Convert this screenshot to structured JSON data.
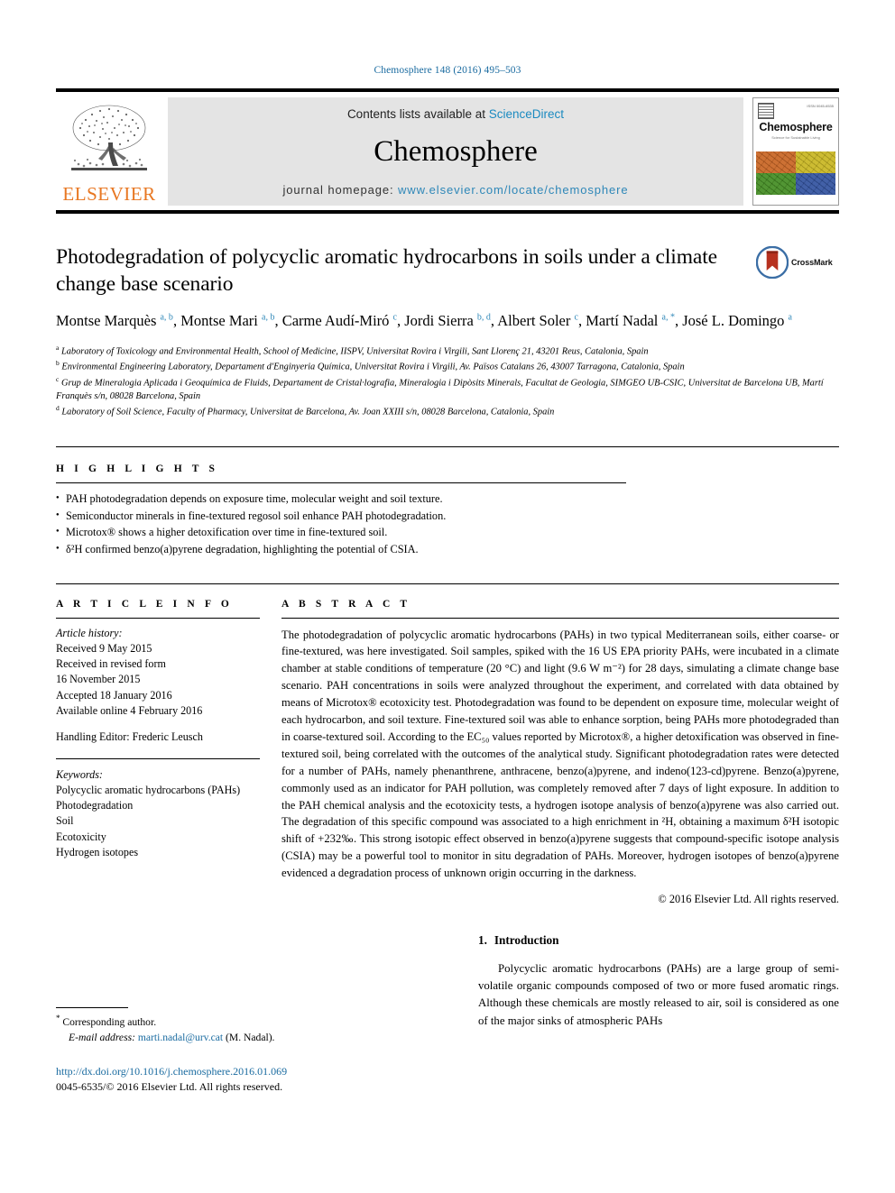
{
  "running_head": "Chemosphere 148 (2016) 495–503",
  "masthead": {
    "contents_prefix": "Contents lists available at ",
    "sciencedirect": "ScienceDirect",
    "journal_name": "Chemosphere",
    "homepage_prefix": "journal homepage: ",
    "homepage_url": "www.elsevier.com/locate/chemosphere",
    "publisher": "ELSEVIER",
    "cover": {
      "title": "Chemosphere",
      "subtitle": "Science for Sustainable Living",
      "issn": "ISSN 0045-6535",
      "colors": [
        "#c8621f",
        "#c8b51d",
        "#3f8a1e",
        "#2e4f9e"
      ]
    }
  },
  "article": {
    "title": "Photodegradation of polycyclic aromatic hydrocarbons in soils under a climate change base scenario",
    "crossmark_label": "CrossMark",
    "authors_html": "Montse Marquès <sup>a, b</sup>, Montse Mari <sup>a, b</sup>, Carme Audí-Miró <sup>c</sup>, Jordi Sierra <sup>b, d</sup>, Albert Soler <sup>c</sup>, Martí Nadal <sup>a, *</sup>, José L. Domingo <sup>a</sup>",
    "affiliations": [
      {
        "letter": "a",
        "text": "Laboratory of Toxicology and Environmental Health, School of Medicine, IISPV, Universitat Rovira i Virgili, Sant Llorenç 21, 43201 Reus, Catalonia, Spain"
      },
      {
        "letter": "b",
        "text": "Environmental Engineering Laboratory, Departament d'Enginyeria Química, Universitat Rovira i Virgili, Av. Països Catalans 26, 43007 Tarragona, Catalonia, Spain"
      },
      {
        "letter": "c",
        "text": "Grup de Mineralogia Aplicada i Geoquímica de Fluids, Departament de Cristal·lografia, Mineralogia i Dipòsits Minerals, Facultat de Geologia, SIMGEO UB-CSIC, Universitat de Barcelona UB, Martí Franquès s/n, 08028 Barcelona, Spain"
      },
      {
        "letter": "d",
        "text": "Laboratory of Soil Science, Faculty of Pharmacy, Universitat de Barcelona, Av. Joan XXIII s/n, 08028 Barcelona, Catalonia, Spain"
      }
    ]
  },
  "highlights": {
    "heading": "H I G H L I G H T S",
    "items": [
      "PAH photodegradation depends on exposure time, molecular weight and soil texture.",
      "Semiconductor minerals in fine-textured regosol soil enhance PAH photodegradation.",
      "Microtox® shows a higher detoxification over time in fine-textured soil.",
      "δ²H confirmed benzo(a)pyrene degradation, highlighting the potential of CSIA."
    ]
  },
  "article_info": {
    "heading": "A R T I C L E   I N F O",
    "history_label": "Article history:",
    "history": [
      "Received 9 May 2015",
      "Received in revised form",
      "16 November 2015",
      "Accepted 18 January 2016",
      "Available online 4 February 2016"
    ],
    "handling_editor": "Handling Editor: Frederic Leusch",
    "keywords_label": "Keywords:",
    "keywords": [
      "Polycyclic aromatic hydrocarbons (PAHs)",
      "Photodegradation",
      "Soil",
      "Ecotoxicity",
      "Hydrogen isotopes"
    ]
  },
  "abstract": {
    "heading": "A B S T R A C T",
    "text": "The photodegradation of polycyclic aromatic hydrocarbons (PAHs) in two typical Mediterranean soils, either coarse- or fine-textured, was here investigated. Soil samples, spiked with the 16 US EPA priority PAHs, were incubated in a climate chamber at stable conditions of temperature (20 °C) and light (9.6 W m⁻²) for 28 days, simulating a climate change base scenario. PAH concentrations in soils were analyzed throughout the experiment, and correlated with data obtained by means of Microtox® ecotoxicity test. Photodegradation was found to be dependent on exposure time, molecular weight of each hydrocarbon, and soil texture. Fine-textured soil was able to enhance sorption, being PAHs more photodegraded than in coarse-textured soil. According to the EC₅₀ values reported by Microtox®, a higher detoxification was observed in fine-textured soil, being correlated with the outcomes of the analytical study. Significant photodegradation rates were detected for a number of PAHs, namely phenanthrene, anthracene, benzo(a)pyrene, and indeno(123-cd)pyrene. Benzo(a)pyrene, commonly used as an indicator for PAH pollution, was completely removed after 7 days of light exposure. In addition to the PAH chemical analysis and the ecotoxicity tests, a hydrogen isotope analysis of benzo(a)pyrene was also carried out. The degradation of this specific compound was associated to a high enrichment in ²H, obtaining a maximum δ²H isotopic shift of +232‰. This strong isotopic effect observed in benzo(a)pyrene suggests that compound-specific isotope analysis (CSIA) may be a powerful tool to monitor in situ degradation of PAHs. Moreover, hydrogen isotopes of benzo(a)pyrene evidenced a degradation process of unknown origin occurring in the darkness.",
    "copyright": "© 2016 Elsevier Ltd. All rights reserved."
  },
  "introduction": {
    "number": "1.",
    "heading": "Introduction",
    "paragraph": "Polycyclic aromatic hydrocarbons (PAHs) are a large group of semi-volatile organic compounds composed of two or more fused aromatic rings. Although these chemicals are mostly released to air, soil is considered as one of the major sinks of atmospheric PAHs"
  },
  "footer": {
    "corresponding_author": "Corresponding author.",
    "email_label": "E-mail address:",
    "email": "marti.nadal@urv.cat",
    "email_suffix": "(M. Nadal).",
    "doi": "http://dx.doi.org/10.1016/j.chemosphere.2016.01.069",
    "issn_line": "0045-6535/© 2016 Elsevier Ltd. All rights reserved."
  }
}
